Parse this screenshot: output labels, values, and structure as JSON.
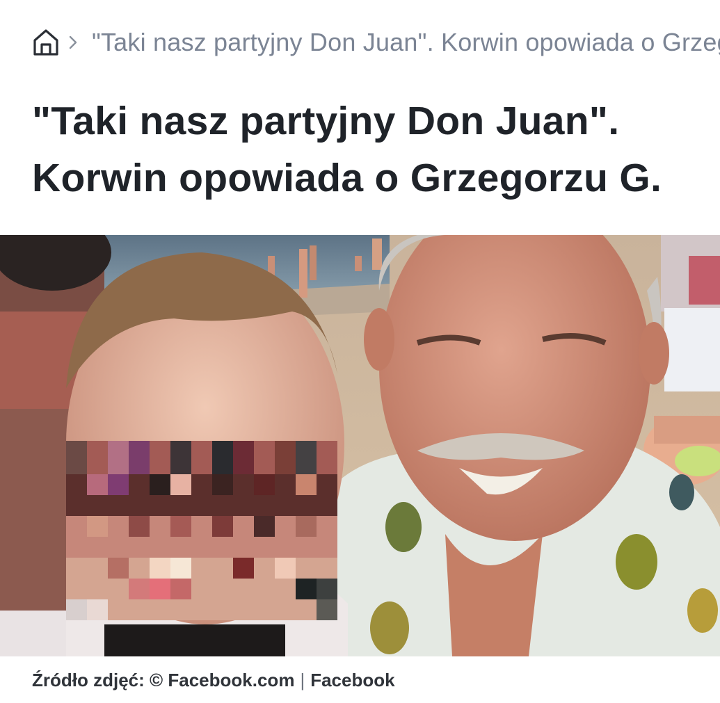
{
  "breadcrumb": {
    "home_icon": "home-icon",
    "separator_icon": "chevron-right-icon",
    "current": "\"Taki nasz partyjny Don Juan\". Korwin opowiada o Grzegorzu G."
  },
  "article": {
    "title_line1": "\"Taki nasz partyjny Don Juan\".",
    "title_line2": "Korwin opowiada o Grzegorzu G."
  },
  "photo": {
    "credit_prefix": "Źródło zdjęć: © Facebook.com",
    "credit_separator": "|",
    "credit_source": "Facebook"
  },
  "colors": {
    "title": "#1f2329",
    "breadcrumb_text": "#7b8494",
    "caption_text": "#30343a"
  }
}
